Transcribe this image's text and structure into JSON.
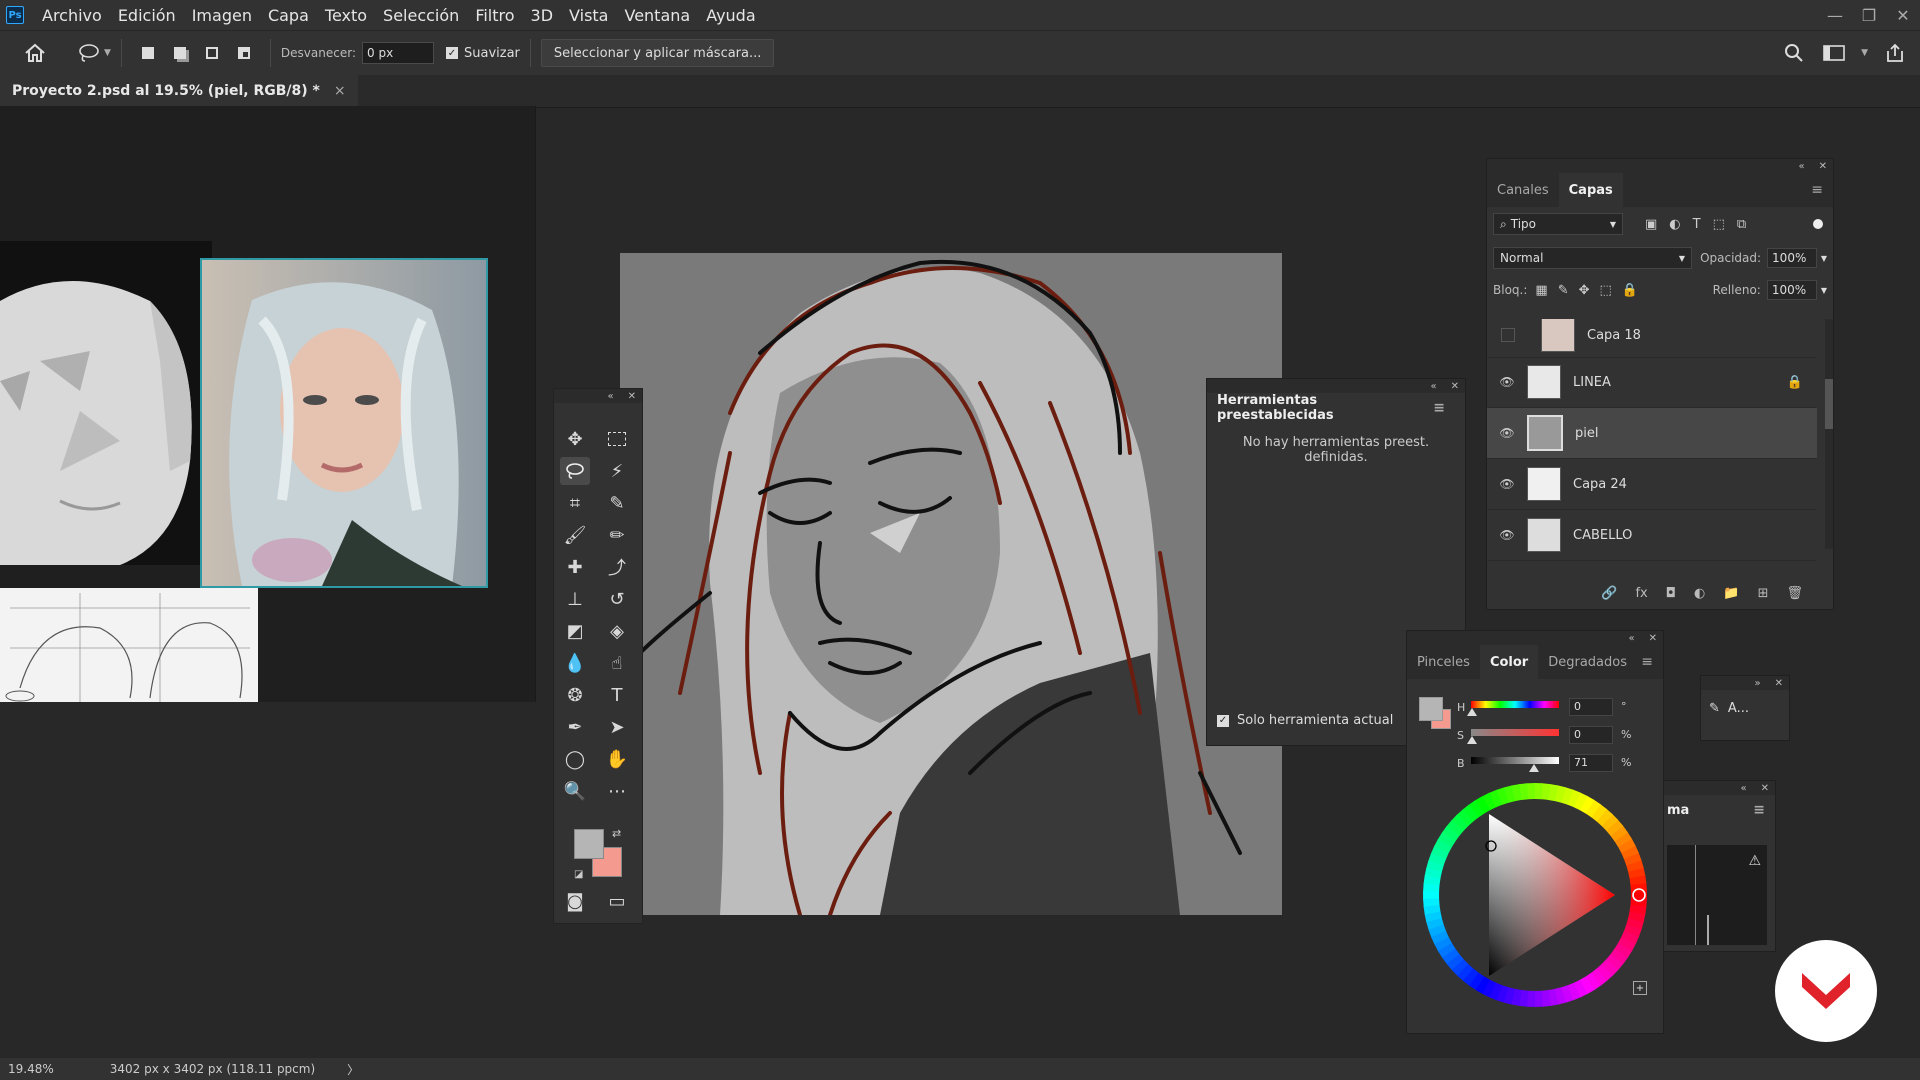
{
  "app": {
    "logo_text": "Ps"
  },
  "menu": {
    "items": [
      "Archivo",
      "Edición",
      "Imagen",
      "Capa",
      "Texto",
      "Selección",
      "Filtro",
      "3D",
      "Vista",
      "Ventana",
      "Ayuda"
    ]
  },
  "window_controls": {
    "minimize": "—",
    "restore": "❐",
    "close": "✕"
  },
  "options": {
    "feather_label": "Desvanecer:",
    "feather_value": "0 px",
    "smooth_label": "Suavizar",
    "smooth_checked": true,
    "select_mask_label": "Seleccionar y aplicar máscara..."
  },
  "document": {
    "tab_title": "Proyecto 2.psd al 19.5% (piel, RGB/8) *",
    "tab_close": "×"
  },
  "presets_panel": {
    "title": "Herramientas preestablecidas",
    "empty_message_line1": "No hay herramientas preest.",
    "empty_message_line2": "definidas.",
    "current_only_label": "Solo herramienta actual",
    "current_only_checked": true
  },
  "layers_panel": {
    "tabs": [
      "Canales",
      "Capas"
    ],
    "active_tab": "Capas",
    "filter_label": "Tipo",
    "blend_mode": "Normal",
    "opacity_label": "Opacidad:",
    "opacity_value": "100%",
    "lock_label": "Bloq.:",
    "fill_label": "Relleno:",
    "fill_value": "100%",
    "layers": [
      {
        "name": "Capa 18",
        "visible": false,
        "selected": false,
        "locked": false
      },
      {
        "name": "LINEA",
        "visible": true,
        "selected": false,
        "locked": true
      },
      {
        "name": "piel",
        "visible": true,
        "selected": true,
        "locked": false
      },
      {
        "name": "Capa 24",
        "visible": true,
        "selected": false,
        "locked": false
      },
      {
        "name": "CABELLO",
        "visible": true,
        "selected": false,
        "locked": false
      }
    ]
  },
  "color_panel": {
    "tabs": [
      "Pinceles",
      "Color",
      "Degradados"
    ],
    "active_tab": "Color",
    "sliders": [
      {
        "label": "H",
        "value": "0",
        "unit": "°",
        "fraction": 0.0
      },
      {
        "label": "S",
        "value": "0",
        "unit": "%",
        "fraction": 0.0
      },
      {
        "label": "B",
        "value": "71",
        "unit": "%",
        "fraction": 0.71
      }
    ],
    "foreground_color": "#b5b5b5",
    "background_color": "#f59a8f"
  },
  "mini_panel": {
    "label": "A..."
  },
  "histogram_panel": {
    "tab_fragment": "ma",
    "warning_icon": "⚠"
  },
  "status": {
    "zoom": "19.48%",
    "doc_info": "3402 px x 3402 px (118.11 ppcm)",
    "arrow": "〉"
  },
  "colors": {
    "accent": "#31a8ff",
    "selected_row": "#474747",
    "sketch_line": "#6b1e0f"
  }
}
